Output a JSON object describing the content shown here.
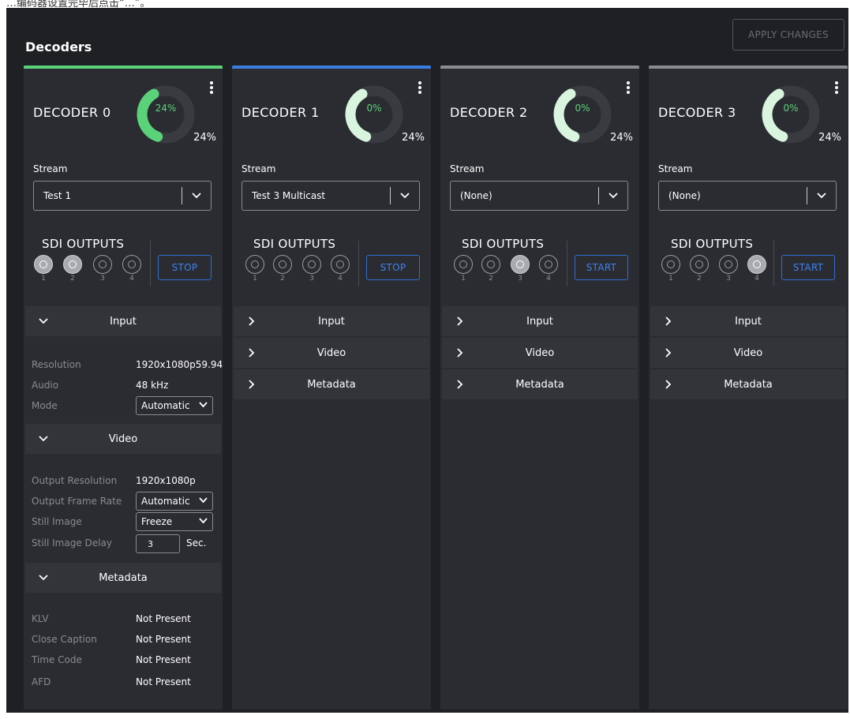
{
  "top_caption": "…编码器设置完毕后点击“…”。",
  "page": {
    "title": "Decoders",
    "apply_label": "APPLY CHANGES"
  },
  "decoders": [
    {
      "name": "DECODER 0",
      "bar_color": "#5ad27a",
      "gauge_center": "24%",
      "gauge_right": "24%",
      "gauge_value": 24,
      "gauge_fill_color": "#5ad27a",
      "gauge_center_color": "#5ad27a",
      "stream_label": "Stream",
      "stream_value": "Test 1",
      "sdi_label": "SDI OUTPUTS",
      "ports": [
        "1",
        "2",
        "3",
        "4"
      ],
      "active_ports": [
        1,
        2
      ],
      "action_label": "STOP",
      "sections": {
        "input": "Input",
        "video": "Video",
        "metadata": "Metadata"
      },
      "input": {
        "resolution_label": "Resolution",
        "resolution_value": "1920x1080p59.94",
        "audio_label": "Audio",
        "audio_value": "48 kHz",
        "mode_label": "Mode",
        "mode_value": "Automatic"
      },
      "video": {
        "out_res_label": "Output Resolution",
        "out_res_value": "1920x1080p",
        "out_fps_label": "Output Frame Rate",
        "out_fps_value": "Automatic",
        "still_label": "Still Image",
        "still_value": "Freeze",
        "delay_label": "Still Image Delay",
        "delay_value": "3",
        "delay_unit": "Sec."
      },
      "metadata": {
        "klv_label": "KLV",
        "klv_value": "Not Present",
        "cc_label": "Close Caption",
        "cc_value": "Not Present",
        "tc_label": "Time Code",
        "tc_value": "Not Present",
        "afd_label": "AFD",
        "afd_value": "Not Present"
      }
    },
    {
      "name": "DECODER 1",
      "bar_color": "#3b7de0",
      "gauge_center": "0%",
      "gauge_right": "24%",
      "gauge_value": 24,
      "gauge_fill_color": "#d9f5df",
      "gauge_center_color": "#5ad27a",
      "stream_label": "Stream",
      "stream_value": "Test 3 Multicast",
      "sdi_label": "SDI OUTPUTS",
      "ports": [
        "1",
        "2",
        "3",
        "4"
      ],
      "active_ports": [],
      "action_label": "STOP",
      "sections": {
        "input": "Input",
        "video": "Video",
        "metadata": "Metadata"
      }
    },
    {
      "name": "DECODER 2",
      "bar_color": "#8b8c90",
      "gauge_center": "0%",
      "gauge_right": "24%",
      "gauge_value": 24,
      "gauge_fill_color": "#d9f5df",
      "gauge_center_color": "#5ad27a",
      "stream_label": "Stream",
      "stream_value": "(None)",
      "sdi_label": "SDI OUTPUTS",
      "ports": [
        "1",
        "2",
        "3",
        "4"
      ],
      "active_ports": [
        3
      ],
      "action_label": "START",
      "sections": {
        "input": "Input",
        "video": "Video",
        "metadata": "Metadata"
      }
    },
    {
      "name": "DECODER 3",
      "bar_color": "#8b8c90",
      "gauge_center": "0%",
      "gauge_right": "24%",
      "gauge_value": 24,
      "gauge_fill_color": "#d9f5df",
      "gauge_center_color": "#5ad27a",
      "stream_label": "Stream",
      "stream_value": "(None)",
      "sdi_label": "SDI OUTPUTS",
      "ports": [
        "1",
        "2",
        "3",
        "4"
      ],
      "active_ports": [
        4
      ],
      "action_label": "START",
      "sections": {
        "input": "Input",
        "video": "Video",
        "metadata": "Metadata"
      }
    }
  ]
}
